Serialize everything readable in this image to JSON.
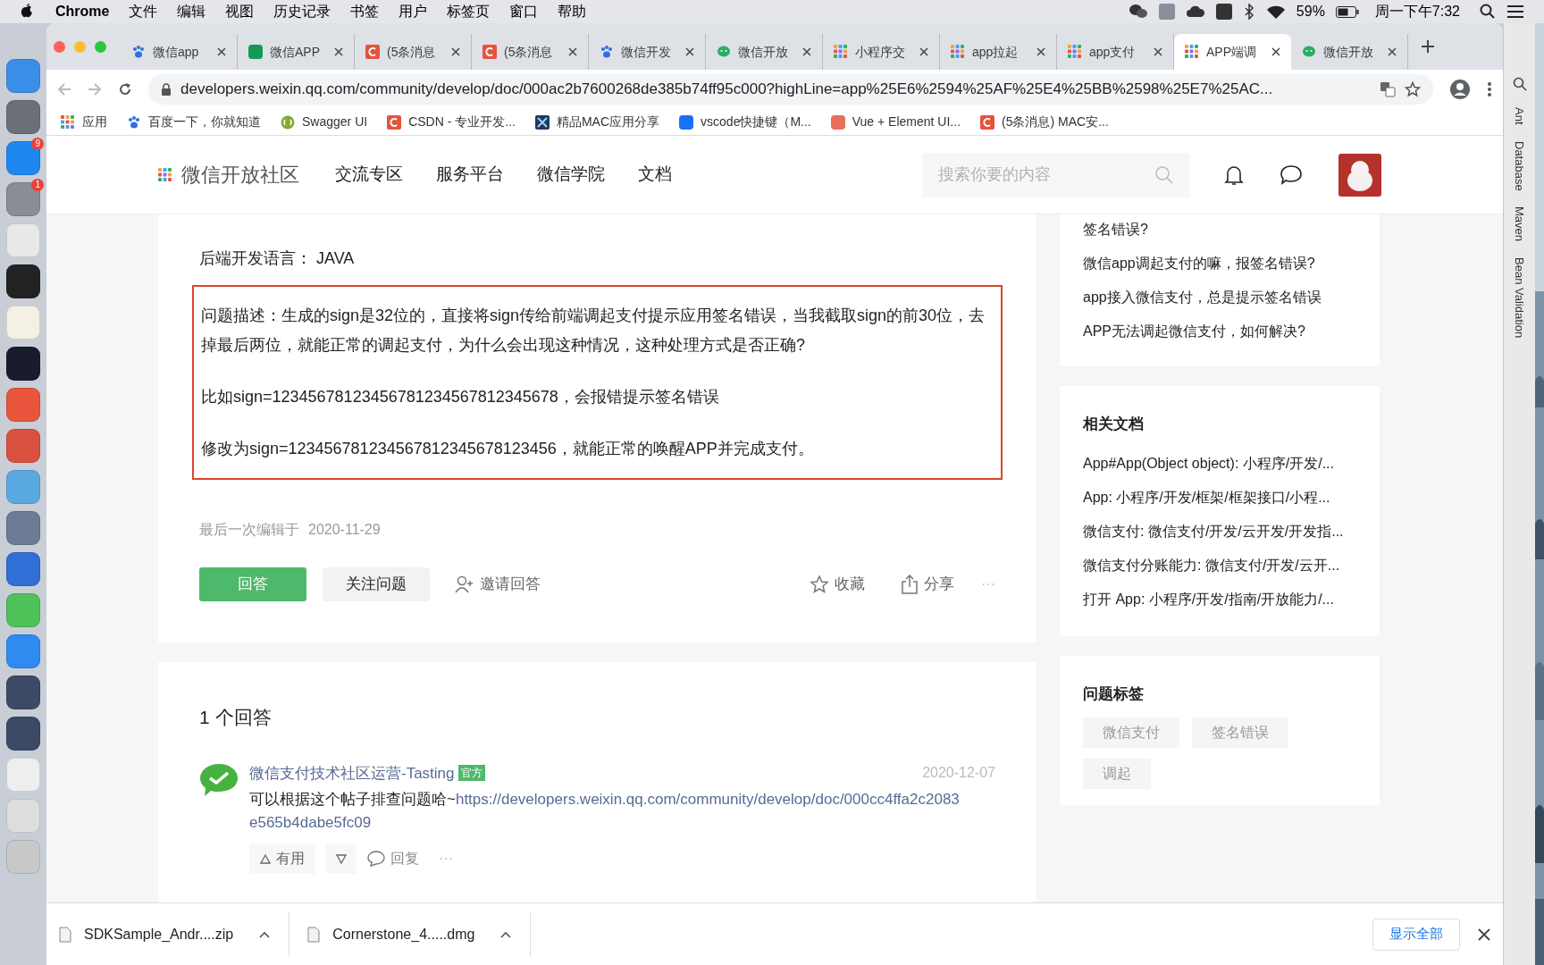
{
  "menu_bar": {
    "app": "Chrome",
    "menus": [
      "文件",
      "编辑",
      "视图",
      "历史记录",
      "书签",
      "用户",
      "标签页",
      "窗口",
      "帮助"
    ],
    "battery": "59%",
    "clock": "周一下午7:32"
  },
  "dock": [
    {
      "color": "#3b8ee8"
    },
    {
      "color": "#6b6f78"
    },
    {
      "color": "#1e88f0",
      "badge": "9"
    },
    {
      "color": "#8a8d93",
      "badge": "1"
    },
    {
      "color": "#e8e8e8"
    },
    {
      "color": "#222222"
    },
    {
      "color": "#f4f1e4"
    },
    {
      "color": "#1b1b2e"
    },
    {
      "color": "#e8553c"
    },
    {
      "color": "#d9503f"
    },
    {
      "color": "#5aa8e0"
    },
    {
      "color": "#6b7c94"
    },
    {
      "color": "#2f6fd6"
    },
    {
      "color": "#4fc25a"
    },
    {
      "color": "#2e8bf0"
    },
    {
      "color": "#3c4a66"
    },
    {
      "color": "#3c4a66"
    },
    {
      "color": "#eeeeee"
    },
    {
      "color": "#dddddd"
    },
    {
      "color": "#c8c8c8"
    }
  ],
  "tabs": [
    {
      "label": "微信app",
      "kind": "paw",
      "selected": false
    },
    {
      "label": "微信APP",
      "kind": "sf",
      "selected": false
    },
    {
      "label": "(5条消息",
      "kind": "csdn",
      "selected": false
    },
    {
      "label": "(5条消息",
      "kind": "csdn",
      "selected": false
    },
    {
      "label": "微信开发",
      "kind": "paw",
      "selected": false
    },
    {
      "label": "微信开放",
      "kind": "chat",
      "selected": false
    },
    {
      "label": "小程序交",
      "kind": "grid",
      "selected": false
    },
    {
      "label": "app拉起",
      "kind": "grid",
      "selected": false
    },
    {
      "label": "app支付",
      "kind": "grid",
      "selected": false
    },
    {
      "label": "APP端调",
      "kind": "grid",
      "selected": true
    },
    {
      "label": "微信开放",
      "kind": "chat",
      "selected": false
    }
  ],
  "address": "developers.weixin.qq.com/community/develop/doc/000ac2b7600268de385b74ff95c000?highLine=app%25E6%2594%25AF%25E4%25BB%2598%25E7%25AC...",
  "bookmarks": [
    {
      "label": "应用",
      "kind": "apps"
    },
    {
      "label": "百度一下，你就知道",
      "kind": "paw"
    },
    {
      "label": "Swagger UI",
      "kind": "swagger"
    },
    {
      "label": "CSDN - 专业开发...",
      "kind": "csdn"
    },
    {
      "label": "精品MAC应用分享",
      "kind": "x"
    },
    {
      "label": "vscode快捷键（M...",
      "kind": "zhi"
    },
    {
      "label": "Vue + Element UI...",
      "kind": "jian"
    },
    {
      "label": "(5条消息) MAC安...",
      "kind": "csdn"
    }
  ],
  "site_header": {
    "logo_text": "微信开放社区",
    "nav": [
      "交流专区",
      "服务平台",
      "微信学院",
      "文档"
    ],
    "search_placeholder": "搜索你要的内容"
  },
  "question": {
    "language_line": "后端开发语言： JAVA",
    "highlighted_paragraphs": [
      "问题描述：生成的sign是32位的，直接将sign传给前端调起支付提示应用签名错误，当我截取sign的前30位，去掉最后两位，就能正常的调起支付，为什么会出现这种情况，这种处理方式是否正确?",
      "比如sign=12345678123456781234567812345678，会报错提示签名错误",
      "修改为sign=123456781234567812345678123456，就能正常的唤醒APP并完成支付。"
    ],
    "edited": "最后一次编辑于",
    "edited_date": "2020-11-29",
    "actions": {
      "answer": "回答",
      "follow": "关注问题",
      "invite": "邀请回答",
      "favorite": "收藏",
      "share": "分享",
      "more": "···"
    }
  },
  "answers": {
    "title": "1 个回答",
    "items": [
      {
        "author": "微信支付技术社区运营-Tasting",
        "badge": "官方",
        "date": "2020-12-07",
        "text": "可以根据这个帖子排查问题哈~",
        "link_lines": [
          "https://developers.weixin.qq.com/community/develop/doc/000cc4ffa2c2083",
          "e565b4dabe5fc09"
        ],
        "useful": "有用",
        "reply": "回复",
        "more": "···"
      }
    ]
  },
  "sidebar": {
    "related_questions": [
      "签名错误?",
      "微信app调起支付的嘛，报签名错误?",
      "app接入微信支付，总是提示签名错误",
      "APP无法调起微信支付，如何解决?"
    ],
    "related_docs": {
      "title": "相关文档",
      "items": [
        "App#App(Object object): 小程序/开发/...",
        "App: 小程序/开发/框架/框架接口/小程...",
        "微信支付: 微信支付/开发/云开发/开发指...",
        "微信支付分账能力: 微信支付/开发/云开...",
        "打开 App: 小程序/开发/指南/开放能力/..."
      ]
    },
    "tags": {
      "title": "问题标签",
      "items": [
        "微信支付",
        "签名错误",
        "调起"
      ]
    }
  },
  "ide_tool_strip": [
    "Ant",
    "Database",
    "Maven",
    "Bean Validation"
  ],
  "downloads": {
    "items": [
      "SDKSample_Andr....zip",
      "Cornerstone_4.....dmg"
    ],
    "show_all": "显示全部"
  }
}
